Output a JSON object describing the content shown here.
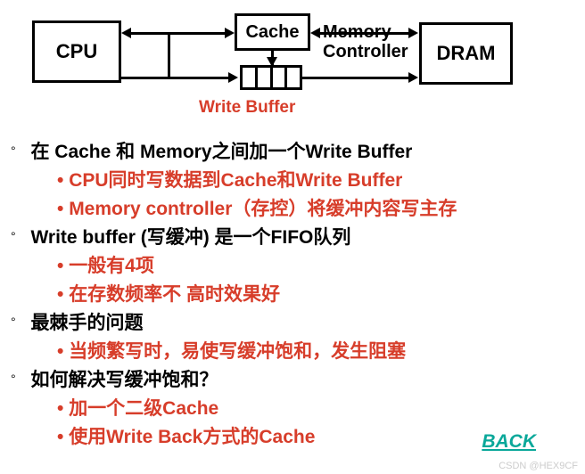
{
  "diagram": {
    "cpu": "CPU",
    "cache": "Cache",
    "dram": "DRAM",
    "memory_controller_l1": "Memory",
    "memory_controller_l2": "Controller",
    "write_buffer_label": "Write Buffer"
  },
  "bullets": [
    {
      "main": "在 Cache 和 Memory之间加一个Write Buffer",
      "subs": [
        "CPU同时写数据到Cache和Write Buffer",
        "Memory controller（存控）将缓冲内容写主存"
      ]
    },
    {
      "main": "Write buffer (写缓冲) 是一个FIFO队列",
      "subs": [
        "一般有4项",
        "在存数频率不 高时效果好"
      ]
    },
    {
      "main": "最棘手的问题",
      "subs": [
        "当频繁写时，易使写缓冲饱和，发生阻塞"
      ]
    },
    {
      "main": "如何解决写缓冲饱和？",
      "subs": [
        "加一个二级Cache",
        "使用Write Back方式的Cache"
      ]
    }
  ],
  "back_label": "BACK",
  "watermark": "CSDN @HEX9CF"
}
